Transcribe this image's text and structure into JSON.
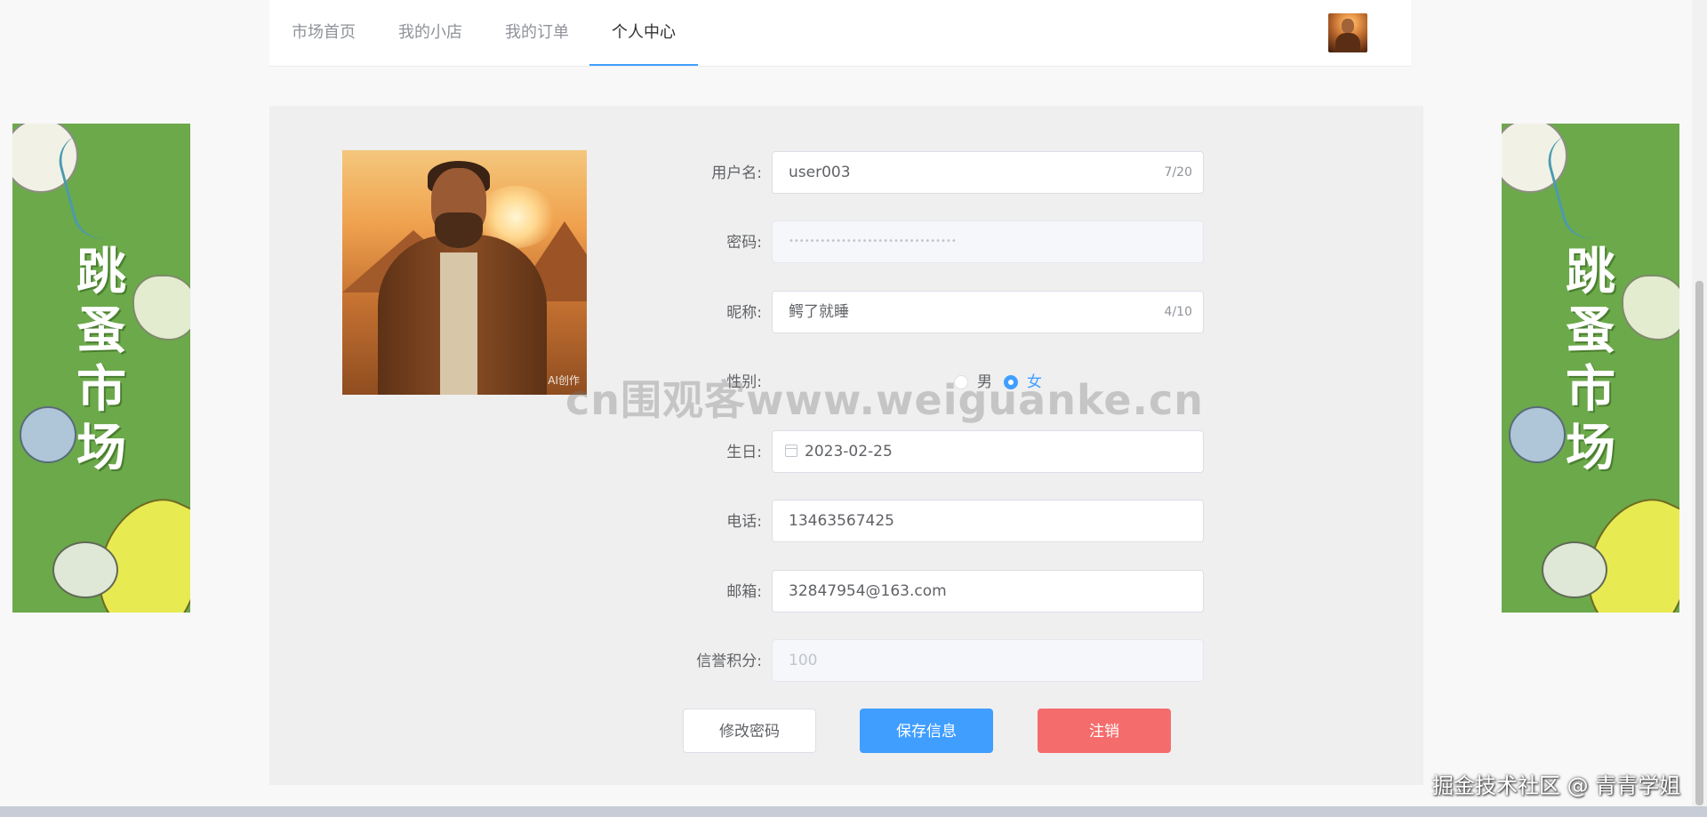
{
  "nav": {
    "items": [
      {
        "label": "市场首页",
        "active": false
      },
      {
        "label": "我的小店",
        "active": false
      },
      {
        "label": "我的订单",
        "active": false
      },
      {
        "label": "个人中心",
        "active": true
      }
    ]
  },
  "banner": {
    "text": "跳蚤市场",
    "color": "#6ba94a"
  },
  "profile": {
    "photo_mark": "AI创作"
  },
  "form": {
    "username": {
      "label": "用户名:",
      "value": "user003",
      "count": "7/20"
    },
    "password": {
      "label": "密码:",
      "value": "••••••••••••••••••••••••••••••••"
    },
    "nickname": {
      "label": "昵称:",
      "value": "鳄了就睡",
      "count": "4/10"
    },
    "gender": {
      "label": "性别:",
      "options": [
        "男",
        "女"
      ],
      "selected": "女"
    },
    "birthday": {
      "label": "生日:",
      "value": "2023-02-25"
    },
    "phone": {
      "label": "电话:",
      "value": "13463567425"
    },
    "email": {
      "label": "邮箱:",
      "value": "32847954@163.com"
    },
    "credit": {
      "label": "信誉积分:",
      "value": "100"
    }
  },
  "buttons": {
    "change_password": "修改密码",
    "save_info": "保存信息",
    "logout": "注销"
  },
  "overlay": {
    "watermark": "cn围观客www.weiguanke.cn",
    "credit": "掘金技术社区 @ 青青学姐"
  },
  "colors": {
    "primary": "#409eff",
    "danger": "#f56c6c"
  }
}
